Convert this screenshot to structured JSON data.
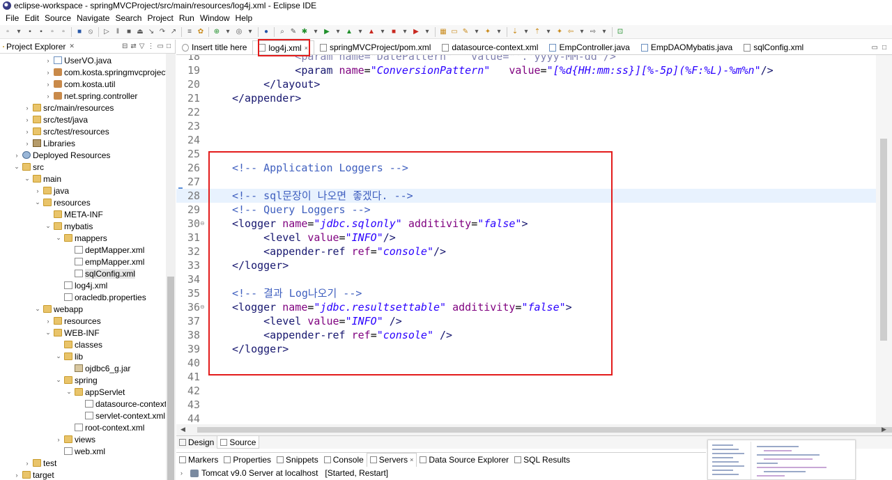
{
  "window": {
    "title": "eclipse-workspace - springMVCProject/src/main/resources/log4j.xml - Eclipse IDE"
  },
  "menu": [
    "File",
    "Edit",
    "Source",
    "Navigate",
    "Search",
    "Project",
    "Run",
    "Window",
    "Help"
  ],
  "left_panel": {
    "title": "Project Explorer",
    "tree": [
      {
        "label": "UserVO.java",
        "icon": "java-file-icon",
        "arrow": "collapsed"
      },
      {
        "label": "com.kosta.springmvcproject",
        "icon": "package-icon",
        "arrow": "collapsed"
      },
      {
        "label": "com.kosta.util",
        "icon": "package-icon",
        "arrow": "collapsed"
      },
      {
        "label": "net.spring.controller",
        "icon": "package-icon",
        "arrow": "collapsed"
      },
      {
        "label": "src/main/resources",
        "icon": "source-folder-icon",
        "arrow": "collapsed"
      },
      {
        "label": "src/test/java",
        "icon": "source-folder-icon",
        "arrow": "collapsed"
      },
      {
        "label": "src/test/resources",
        "icon": "source-folder-icon",
        "arrow": "collapsed"
      },
      {
        "label": "Libraries",
        "icon": "library-icon",
        "arrow": "collapsed"
      },
      {
        "label": "Deployed Resources",
        "icon": "deployed-resources-icon",
        "arrow": "collapsed"
      },
      {
        "label": "src",
        "icon": "folder-icon",
        "arrow": "expanded"
      },
      {
        "label": "main",
        "icon": "folder-icon",
        "arrow": "expanded"
      },
      {
        "label": "java",
        "icon": "folder-icon",
        "arrow": "collapsed"
      },
      {
        "label": "resources",
        "icon": "folder-icon",
        "arrow": "expanded"
      },
      {
        "label": "META-INF",
        "icon": "folder-icon",
        "arrow": "none"
      },
      {
        "label": "mybatis",
        "icon": "folder-icon",
        "arrow": "expanded"
      },
      {
        "label": "mappers",
        "icon": "folder-icon",
        "arrow": "expanded"
      },
      {
        "label": "deptMapper.xml",
        "icon": "xml-file-icon",
        "arrow": "none"
      },
      {
        "label": "empMapper.xml",
        "icon": "xml-file-icon",
        "arrow": "none"
      },
      {
        "label": "sqlConfig.xml",
        "icon": "xml-file-icon",
        "arrow": "none",
        "selected": true
      },
      {
        "label": "log4j.xml",
        "icon": "xml-file-icon",
        "arrow": "none"
      },
      {
        "label": "oracledb.properties",
        "icon": "properties-file-icon",
        "arrow": "none"
      },
      {
        "label": "webapp",
        "icon": "folder-icon",
        "arrow": "expanded"
      },
      {
        "label": "resources",
        "icon": "folder-icon",
        "arrow": "collapsed"
      },
      {
        "label": "WEB-INF",
        "icon": "folder-icon",
        "arrow": "expanded"
      },
      {
        "label": "classes",
        "icon": "folder-icon",
        "arrow": "none"
      },
      {
        "label": "lib",
        "icon": "folder-icon",
        "arrow": "expanded"
      },
      {
        "label": "ojdbc6_g.jar",
        "icon": "jar-file-icon",
        "arrow": "none"
      },
      {
        "label": "spring",
        "icon": "folder-icon",
        "arrow": "expanded"
      },
      {
        "label": "appServlet",
        "icon": "folder-icon",
        "arrow": "expanded"
      },
      {
        "label": "datasource-context.",
        "icon": "spring-xml-icon",
        "arrow": "none"
      },
      {
        "label": "servlet-context.xml",
        "icon": "spring-xml-icon",
        "arrow": "none"
      },
      {
        "label": "root-context.xml",
        "icon": "spring-xml-icon",
        "arrow": "none"
      },
      {
        "label": "views",
        "icon": "folder-icon",
        "arrow": "collapsed"
      },
      {
        "label": "web.xml",
        "icon": "xml-file-icon",
        "arrow": "none"
      },
      {
        "label": "test",
        "icon": "folder-icon",
        "arrow": "collapsed"
      },
      {
        "label": "target",
        "icon": "folder-icon",
        "arrow": "collapsed"
      }
    ]
  },
  "editor_tabs": [
    {
      "label": "Insert title here",
      "icon": "browser-icon",
      "active": false
    },
    {
      "label": "log4j.xml",
      "icon": "xml-file-icon",
      "active": true,
      "close": "×"
    },
    {
      "label": "springMVCProject/pom.xml",
      "icon": "maven-icon",
      "active": false
    },
    {
      "label": "datasource-context.xml",
      "icon": "spring-xml-icon",
      "active": false
    },
    {
      "label": "EmpController.java",
      "icon": "java-file-icon",
      "active": false
    },
    {
      "label": "EmpDAOMybatis.java",
      "icon": "java-file-icon",
      "active": false
    },
    {
      "label": "sqlConfig.xml",
      "icon": "xml-file-icon",
      "active": false
    }
  ],
  "editor": {
    "current_line": 28,
    "lines": [
      {
        "n": "18",
        "segments": [
          {
            "t": "          <param name=\"DatePattern\"   value=\"'.'yyyy-MM-dd\"/>",
            "c": "ghost"
          }
        ]
      },
      {
        "n": "19",
        "segments": [
          {
            "t": "          <param ",
            "c": "tag"
          },
          {
            "t": "name",
            "c": "attr"
          },
          {
            "t": "=",
            "c": "txt"
          },
          {
            "t": "\"ConversionPattern\"",
            "c": "val"
          },
          {
            "t": "   ",
            "c": "txt"
          },
          {
            "t": "value",
            "c": "attr"
          },
          {
            "t": "=",
            "c": "txt"
          },
          {
            "t": "\"[%d{HH:mm:ss}][%-5p](%F:%L)-%m%n\"",
            "c": "val"
          },
          {
            "t": "/>",
            "c": "tag"
          }
        ]
      },
      {
        "n": "20",
        "segments": [
          {
            "t": "     </layout>",
            "c": "tag"
          }
        ]
      },
      {
        "n": "21",
        "segments": [
          {
            "t": "</appender>",
            "c": "tag"
          }
        ]
      },
      {
        "n": "22",
        "segments": []
      },
      {
        "n": "23",
        "segments": []
      },
      {
        "n": "24",
        "segments": []
      },
      {
        "n": "25",
        "segments": []
      },
      {
        "n": "26",
        "segments": [
          {
            "t": "<!-- Application Loggers -->",
            "c": "cmt"
          }
        ]
      },
      {
        "n": "27",
        "segments": []
      },
      {
        "n": "28",
        "segments": [
          {
            "t": "<!-- sql문장이 나오면 좋겠다. -->",
            "c": "cmt"
          }
        ]
      },
      {
        "n": "29",
        "segments": [
          {
            "t": "<!-- Query Loggers -->",
            "c": "cmt"
          }
        ]
      },
      {
        "n": "30",
        "fold": true,
        "segments": [
          {
            "t": "<logger ",
            "c": "tag"
          },
          {
            "t": "name",
            "c": "attr"
          },
          {
            "t": "=",
            "c": "txt"
          },
          {
            "t": "\"jdbc.sqlonly\"",
            "c": "val"
          },
          {
            "t": " ",
            "c": "txt"
          },
          {
            "t": "additivity",
            "c": "attr"
          },
          {
            "t": "=",
            "c": "txt"
          },
          {
            "t": "\"false\"",
            "c": "val"
          },
          {
            "t": ">",
            "c": "tag"
          }
        ]
      },
      {
        "n": "31",
        "segments": [
          {
            "t": "     <level ",
            "c": "tag"
          },
          {
            "t": "value",
            "c": "attr"
          },
          {
            "t": "=",
            "c": "txt"
          },
          {
            "t": "\"INFO\"",
            "c": "val"
          },
          {
            "t": "/>",
            "c": "tag"
          }
        ]
      },
      {
        "n": "32",
        "segments": [
          {
            "t": "     <appender-ref ",
            "c": "tag"
          },
          {
            "t": "ref",
            "c": "attr"
          },
          {
            "t": "=",
            "c": "txt"
          },
          {
            "t": "\"console\"",
            "c": "val"
          },
          {
            "t": "/>",
            "c": "tag"
          }
        ]
      },
      {
        "n": "33",
        "segments": [
          {
            "t": "</logger>",
            "c": "tag"
          }
        ]
      },
      {
        "n": "34",
        "segments": []
      },
      {
        "n": "35",
        "segments": [
          {
            "t": "<!-- 결과 Log나오기 -->",
            "c": "cmt"
          }
        ]
      },
      {
        "n": "36",
        "fold": true,
        "segments": [
          {
            "t": "<logger ",
            "c": "tag"
          },
          {
            "t": "name",
            "c": "attr"
          },
          {
            "t": "=",
            "c": "txt"
          },
          {
            "t": "\"jdbc.resultsettable\"",
            "c": "val"
          },
          {
            "t": " ",
            "c": "txt"
          },
          {
            "t": "additivity",
            "c": "attr"
          },
          {
            "t": "=",
            "c": "txt"
          },
          {
            "t": "\"false\"",
            "c": "val"
          },
          {
            "t": ">",
            "c": "tag"
          }
        ]
      },
      {
        "n": "37",
        "segments": [
          {
            "t": "     <level ",
            "c": "tag"
          },
          {
            "t": "value",
            "c": "attr"
          },
          {
            "t": "=",
            "c": "txt"
          },
          {
            "t": "\"INFO\"",
            "c": "val"
          },
          {
            "t": " />",
            "c": "tag"
          }
        ]
      },
      {
        "n": "38",
        "segments": [
          {
            "t": "     <appender-ref ",
            "c": "tag"
          },
          {
            "t": "ref",
            "c": "attr"
          },
          {
            "t": "=",
            "c": "txt"
          },
          {
            "t": "\"console\"",
            "c": "val"
          },
          {
            "t": " />",
            "c": "tag"
          }
        ]
      },
      {
        "n": "39",
        "segments": [
          {
            "t": "</logger>",
            "c": "tag"
          }
        ]
      },
      {
        "n": "40",
        "segments": []
      },
      {
        "n": "41",
        "segments": []
      },
      {
        "n": "42",
        "segments": []
      },
      {
        "n": "43",
        "segments": []
      },
      {
        "n": "44",
        "segments": []
      }
    ]
  },
  "design_tabs": [
    {
      "label": "Design",
      "active": false
    },
    {
      "label": "Source",
      "active": true
    }
  ],
  "bottom_views": [
    {
      "label": "Markers",
      "icon": "markers-icon"
    },
    {
      "label": "Properties",
      "icon": "properties-icon"
    },
    {
      "label": "Snippets",
      "icon": "snippets-icon"
    },
    {
      "label": "Console",
      "icon": "console-icon"
    },
    {
      "label": "Servers",
      "icon": "servers-icon",
      "active": true,
      "close": "×"
    },
    {
      "label": "Data Source Explorer",
      "icon": "data-source-icon"
    },
    {
      "label": "SQL Results",
      "icon": "sql-results-icon"
    }
  ],
  "servers": {
    "row": "Tomcat v9.0 Server at localhost",
    "status": "[Started, Restart]"
  },
  "colors": {
    "highlight_red": "#e31b1b",
    "xml_tag": "#17176f",
    "xml_attr": "#7f007f",
    "xml_value": "#2a00ff",
    "xml_comment": "#3f5fbf",
    "current_line": "#e8f2fe"
  }
}
